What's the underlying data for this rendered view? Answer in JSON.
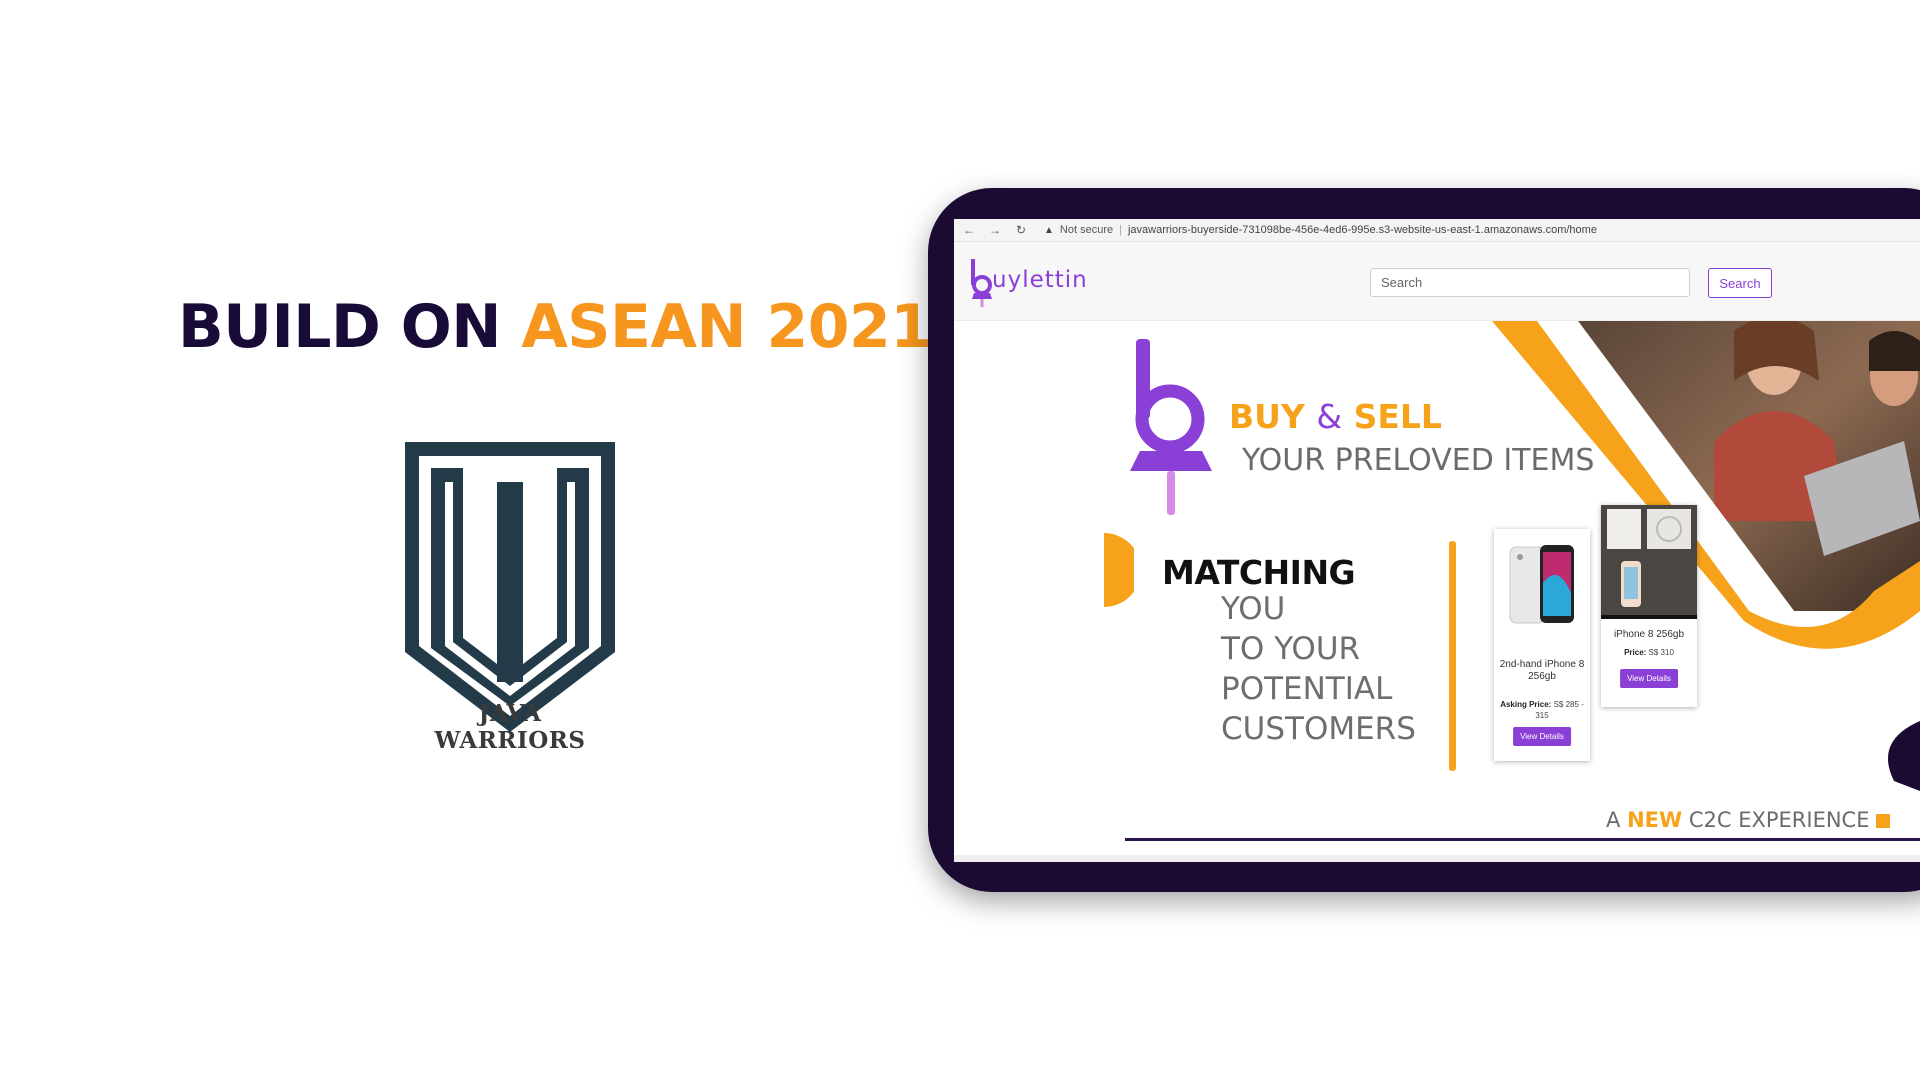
{
  "slide": {
    "title_prefix": "BUILD ON",
    "title_highlight": "ASEAN 2021",
    "team_name": "JAVA WARRIORS"
  },
  "browser": {
    "back_icon": "arrow-left-icon",
    "forward_icon": "arrow-right-icon",
    "reload_icon": "reload-icon",
    "security_warning": "Not secure",
    "url": "javawarriors-buyerside-731098be-456e-4ed6-995e.s3-website-us-east-1.amazonaws.com/home"
  },
  "site": {
    "logo_text": "uylettin",
    "search": {
      "placeholder": "Search",
      "button_label": "Search"
    },
    "banner": {
      "buy": "BUY",
      "amp": "&",
      "sell": "SELL",
      "preloved": "YOUR PRELOVED ITEMS",
      "matching": "MATCHING",
      "lines": [
        "YOU",
        "TO YOUR",
        "POTENTIAL",
        "CUSTOMERS"
      ],
      "tagline_a": "A",
      "tagline_new": "NEW",
      "tagline_rest": "C2C EXPERIENCE"
    },
    "cards": [
      {
        "title": "2nd-hand iPhone 8 256gb",
        "price_label": "Asking Price:",
        "price_value": "S$ 285 - 315",
        "button_label": "View Details"
      },
      {
        "title": "iPhone 8 256gb",
        "price_label": "Price:",
        "price_value": "S$ 310",
        "button_label": "View Details"
      }
    ]
  },
  "colors": {
    "navy": "#190b37",
    "orange": "#f7961e",
    "purple": "#8a3fd6",
    "tablet_frame": "#1b0b33"
  }
}
